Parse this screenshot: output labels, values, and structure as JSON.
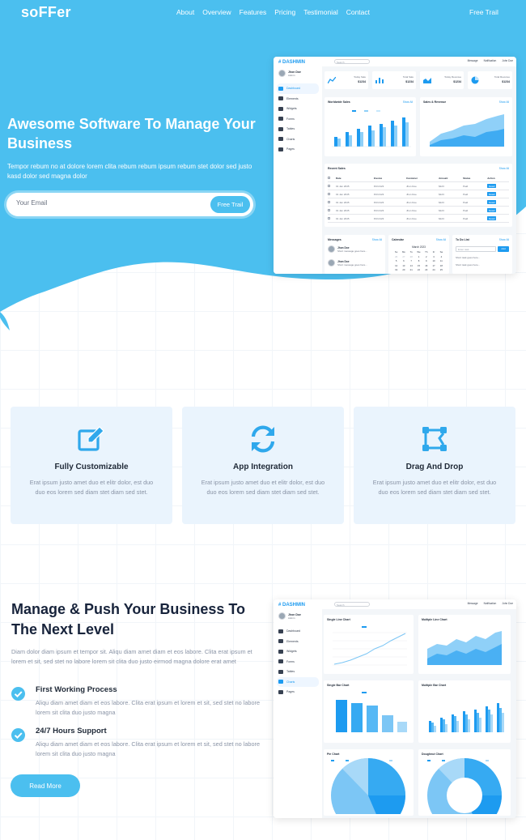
{
  "nav": {
    "logo": "soFFer",
    "links": [
      "About",
      "Overview",
      "Features",
      "Pricing",
      "Testimonial",
      "Contact"
    ],
    "cta": "Free Trail"
  },
  "hero": {
    "title": "Awesome Software To Manage Your Business",
    "subtitle": "Tempor rebum no at dolore lorem clita rebum rebum ipsum rebum stet dolor sed justo kasd dolor sed magna dolor",
    "email_placeholder": "Your Email",
    "button": "Free Trail"
  },
  "dashboard_top": {
    "brand": "# DASHMIN",
    "user_name": "Jhon Doe",
    "user_role": "Admin",
    "search_placeholder": "Search",
    "top_items": [
      "Message",
      "Notification",
      "John Doe"
    ],
    "menu": [
      "Dashboard",
      "Elements",
      "Widgets",
      "Forms",
      "Tables",
      "Charts",
      "Pages"
    ],
    "active_menu": "Dashboard",
    "stats": [
      {
        "label": "Today Sale",
        "value": "$1234"
      },
      {
        "label": "Total Sale",
        "value": "$1234"
      },
      {
        "label": "Today Revenue",
        "value": "$1234"
      },
      {
        "label": "Total Revenue",
        "value": "$1234"
      }
    ],
    "card_worldwide": "Worldwide Sales",
    "card_sales_revenue": "Sales & Revenue",
    "card_recent": "Recent Sales",
    "card_messages": "Messages",
    "card_calendar": "Calendar",
    "card_todo": "To Do List",
    "show_all": "Show All",
    "table_headers": [
      "Date",
      "Invoice",
      "Customer",
      "Amount",
      "Status",
      "Action"
    ],
    "table_row": [
      "01 Jan 2045",
      "INV-0123",
      "Jhon Doe",
      "$123",
      "Paid",
      "Detail"
    ],
    "row_count": 5,
    "messages": [
      {
        "name": "Jhon Doe",
        "text": "Short message goes here..."
      },
      {
        "name": "Jhon Doe",
        "text": "Short message goes here..."
      }
    ],
    "calendar_month": "March 2023",
    "calendar_days": [
      "Su",
      "Mo",
      "Tu",
      "We",
      "Th",
      "Fr",
      "Sa"
    ],
    "todo_placeholder": "Enter task",
    "todo_add": "Add",
    "todo_items": [
      "Short task goes here...",
      "Short task goes here..."
    ]
  },
  "features": [
    {
      "icon": "edit-icon",
      "title": "Fully Customizable",
      "desc": "Erat ipsum justo amet duo et elitr dolor, est duo duo eos lorem sed diam stet diam sed stet."
    },
    {
      "icon": "sync-icon",
      "title": "App Integration",
      "desc": "Erat ipsum justo amet duo et elitr dolor, est duo duo eos lorem sed diam stet diam sed stet."
    },
    {
      "icon": "drag-drop-icon",
      "title": "Drag And Drop",
      "desc": "Erat ipsum justo amet duo et elitr dolor, est duo duo eos lorem sed diam stet diam sed stet."
    }
  ],
  "manage": {
    "title": "Manage & Push Your Business To The Next Level",
    "desc": "Diam dolor diam ipsum et tempor sit. Aliqu diam amet diam et eos labore. Clita erat ipsum et lorem et sit, sed stet no labore lorem sit clita duo justo eirmod magna dolore erat amet",
    "points": [
      {
        "title": "First Working Process",
        "desc": "Aliqu diam amet diam et eos labore. Clita erat ipsum et lorem et sit, sed stet no labore lorem sit clita duo justo magna"
      },
      {
        "title": "24/7 Hours Support",
        "desc": "Aliqu diam amet diam et eos labore. Clita erat ipsum et lorem et sit, sed stet no labore lorem sit clita duo justo magna"
      }
    ],
    "button": "Read More"
  },
  "dashboard_bottom": {
    "brand": "# DASHMIN",
    "user_name": "Jhon Doe",
    "user_role": "Admin",
    "search_placeholder": "Search",
    "top_items": [
      "Message",
      "Notification",
      "John Doe"
    ],
    "menu": [
      "Dashboard",
      "Elements",
      "Widgets",
      "Forms",
      "Tables",
      "Charts",
      "Pages"
    ],
    "active_menu": "Charts",
    "charts": [
      "Single Line Chart",
      "Multiple Line Chart",
      "Single Bar Chart",
      "Multiple Bar Chart",
      "Pie Chart",
      "Doughnut Chart"
    ]
  },
  "colors": {
    "accent": "#4bbfef",
    "hero_bg": "#4bbfef",
    "feature_bg": "#eaf4fd",
    "heading": "#17233b",
    "muted": "#8a94a6"
  }
}
